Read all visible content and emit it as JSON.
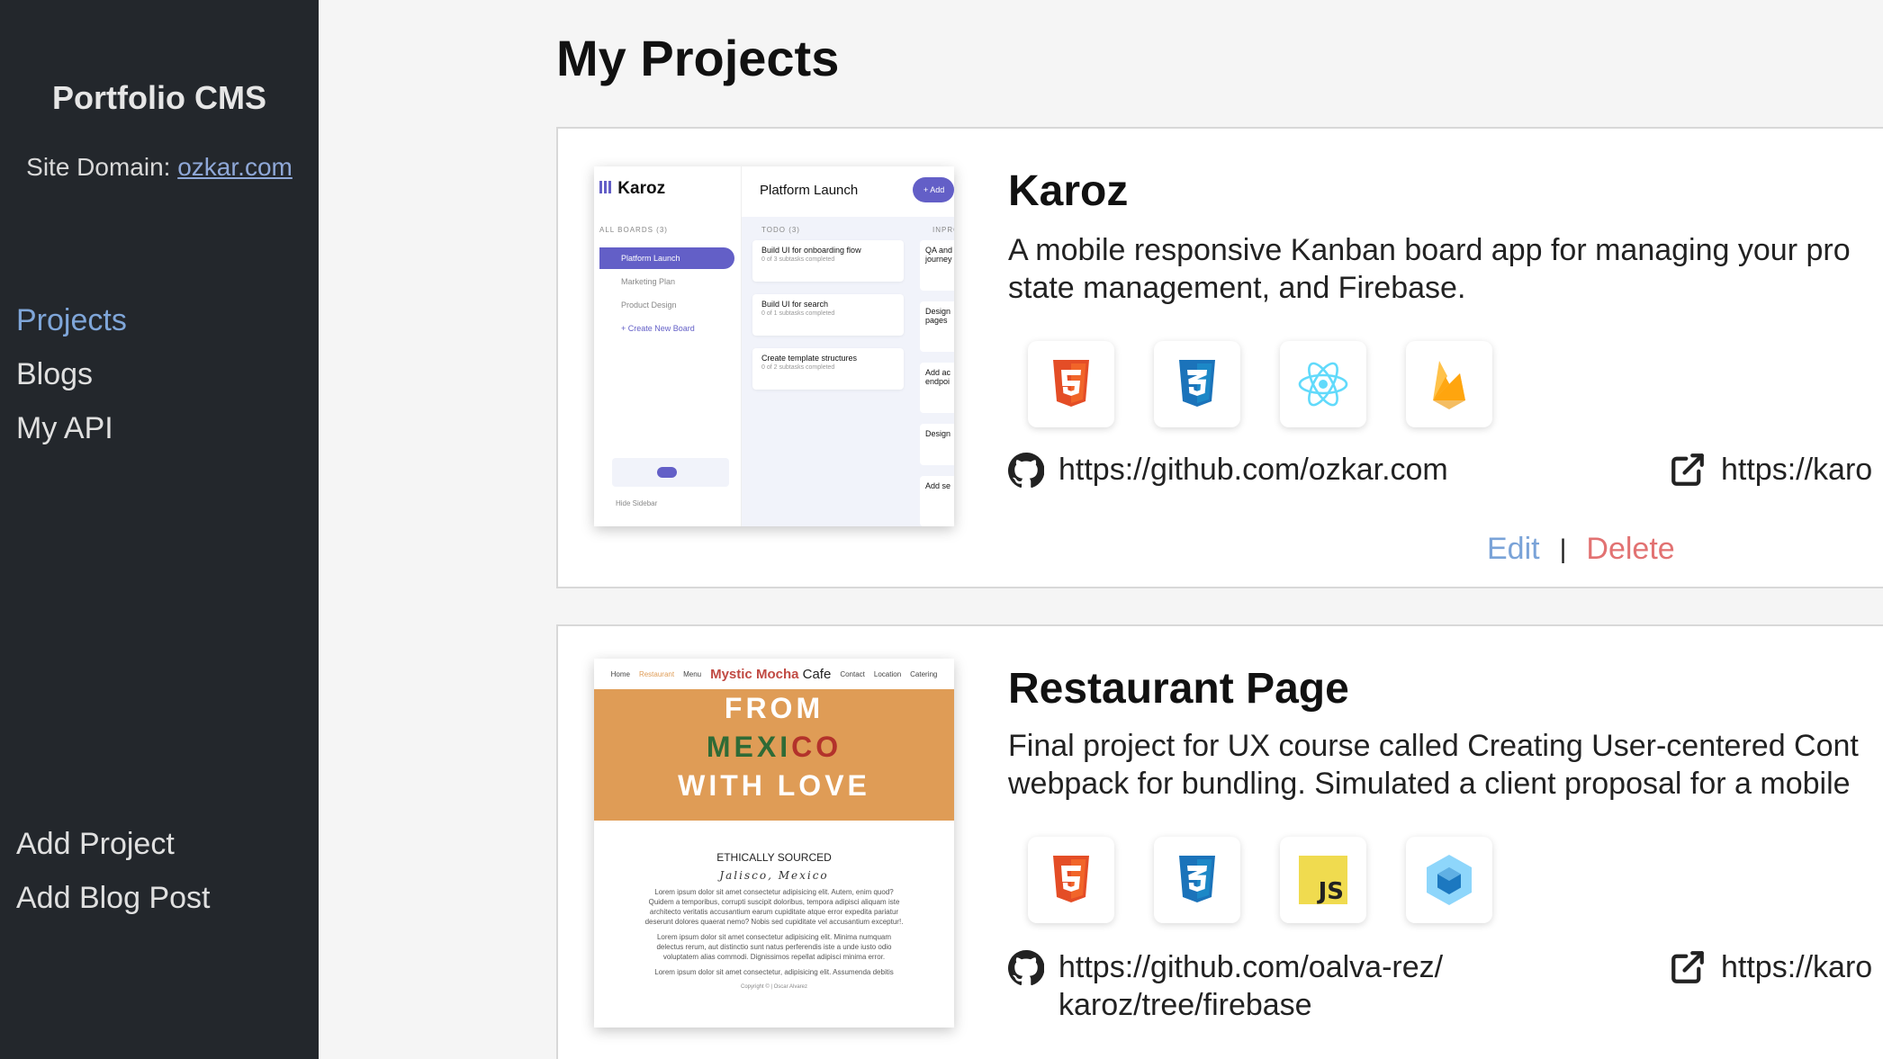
{
  "sidebar": {
    "brand": "Portfolio CMS",
    "domain_label": "Site Domain: ",
    "domain_value": "ozkar.com",
    "nav": [
      "Projects",
      "Blogs",
      "My API"
    ],
    "actions": [
      "Add Project",
      "Add Blog Post"
    ]
  },
  "main": {
    "title": "My Projects",
    "projects": [
      {
        "title": "Karoz",
        "description": "A mobile responsive Kanban board app for managing your pro\nstate management, and Firebase.",
        "techs": [
          "html5-icon",
          "css3-icon",
          "react-icon",
          "firebase-icon"
        ],
        "github": "https://github.com/ozkar.com",
        "live": "https://karo",
        "edit": "Edit",
        "separator": "|",
        "delete": "Delete",
        "thumbnail": {
          "logo": "Karoz",
          "header": "Platform Launch",
          "add": "+ Add",
          "boards_label": "ALL BOARDS (3)",
          "boards": [
            "Platform Launch",
            "Marketing Plan",
            "Product Design",
            "+ Create New Board"
          ],
          "todo_label": "TODO (3)",
          "inprog_label": "INPROG",
          "tasks": [
            {
              "title": "Build UI for onboarding flow",
              "sub": "0 of 3 subtasks completed"
            },
            {
              "title": "Build UI for search",
              "sub": "0 of 1 subtasks completed"
            },
            {
              "title": "Create template structures",
              "sub": "0 of 2 subtasks completed"
            }
          ],
          "tasks2": [
            "QA and journey",
            "Design pages",
            "Add ac endpoi",
            "Design",
            "Add se"
          ],
          "hide": "Hide Sidebar"
        }
      },
      {
        "title": "Restaurant Page",
        "description": "Final project for UX course called Creating User-centered Cont\nwebpack for bundling. Simulated a client proposal for a mobile",
        "techs": [
          "html5-icon",
          "css3-icon",
          "javascript-icon",
          "webpack-icon"
        ],
        "github": "https://github.com/oalva-rez/karoz/tree/firebase",
        "live": "https://karo",
        "thumbnail": {
          "nav_left": [
            "Home",
            "Restaurant",
            "Menu"
          ],
          "brand_main": "Mystic Mocha",
          "brand_suffix": "Cafe",
          "nav_right": [
            "Contact",
            "Location",
            "Catering"
          ],
          "hero_1": "FROM",
          "hero_2a": "MEXI",
          "hero_2b": "CO",
          "hero_3": "WITH LOVE",
          "heading": "ETHICALLY SOURCED",
          "script": "Jalisco, Mexico",
          "para1": "Lorem ipsum dolor sit amet consectetur adipisicing elit. Autem, enim quod? Quidem a temporibus, corrupti suscipit doloribus, tempora adipisci aliquam iste architecto veritatis accusantium earum cupiditate atque error expedita pariatur deserunt dolores quaerat nemo? Nobis sed cupiditate vel accusantium exceptur!.",
          "para2": "Lorem ipsum dolor sit amet consectetur adipisicing elit. Minima numquam delectus rerum, aut distinctio sunt natus perferendis iste a unde iusto odio voluptatem alias commodi. Dignissimos repellat adipisci minima error.",
          "para3": "Lorem ipsum dolor sit amet consectetur, adipisicing elit. Assumenda debitis",
          "footer": "Copyright © | Oscar Alvarez"
        }
      }
    ]
  }
}
